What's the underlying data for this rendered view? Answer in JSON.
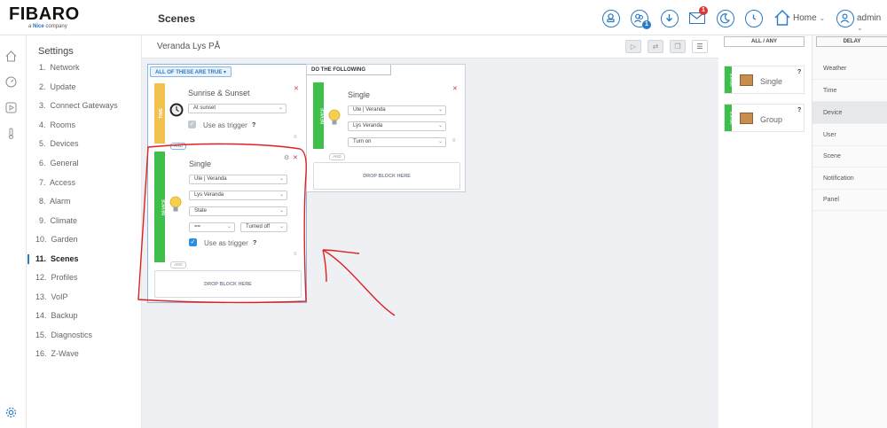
{
  "brand": {
    "name": "FIBARO",
    "tagline_prefix": "a ",
    "tagline_brand": "Nice",
    "tagline_suffix": " company"
  },
  "header": {
    "page_title": "Scenes",
    "home_label": "Home",
    "user_label": "admin",
    "users_badge": "1",
    "messages_badge": "1",
    "accent_color": "#2a7ac5",
    "badge_color": "#d9383a"
  },
  "settings": {
    "title": "Settings",
    "items": [
      {
        "num": "1.",
        "label": "Network"
      },
      {
        "num": "2.",
        "label": "Update"
      },
      {
        "num": "3.",
        "label": "Connect Gateways"
      },
      {
        "num": "4.",
        "label": "Rooms"
      },
      {
        "num": "5.",
        "label": "Devices"
      },
      {
        "num": "6.",
        "label": "General"
      },
      {
        "num": "7.",
        "label": "Access"
      },
      {
        "num": "8.",
        "label": "Alarm"
      },
      {
        "num": "9.",
        "label": "Climate"
      },
      {
        "num": "10.",
        "label": "Garden"
      },
      {
        "num": "11.",
        "label": "Scenes"
      },
      {
        "num": "12.",
        "label": "Profiles"
      },
      {
        "num": "13.",
        "label": "VoIP"
      },
      {
        "num": "14.",
        "label": "Backup"
      },
      {
        "num": "15.",
        "label": "Diagnostics"
      },
      {
        "num": "16.",
        "label": "Z-Wave"
      }
    ],
    "active_index": 10
  },
  "scene": {
    "name": "Veranda Lys PÅ"
  },
  "conditions": {
    "tab_label": "ALL OF THESE ARE TRUE",
    "and_label": "AND",
    "drop_label": "DROP BLOCK HERE",
    "time_block": {
      "strip_label": "TIME",
      "strip_color": "#f2c14e",
      "title": "Sunrise & Sunset",
      "select": "At sunset",
      "trigger_label": "Use as trigger",
      "help": "?"
    },
    "device_block": {
      "strip_label": "DEVICE",
      "strip_color": "#3dbf4a",
      "title": "Single",
      "room": "Ute | Veranda",
      "device": "Lys Veranda",
      "property": "State",
      "operator": "==",
      "value": "Turned off",
      "trigger_label": "Use as trigger",
      "help": "?"
    }
  },
  "actions": {
    "tab_label": "DO THE FOLLOWING",
    "and_label": "AND",
    "drop_label": "DROP BLOCK HERE",
    "device_block": {
      "strip_label": "DEVICE",
      "strip_color": "#3dbf4a",
      "title": "Single",
      "room": "Ute | Veranda",
      "device": "Lys Veranda",
      "action": "Turn on"
    }
  },
  "palette": {
    "headers": [
      "ALL / ANY",
      "DELAY"
    ],
    "cards": [
      {
        "strip": "DEVICE",
        "label": "Single",
        "help": "?"
      },
      {
        "strip": "DEVICE",
        "label": "Group",
        "help": "?"
      }
    ],
    "categories": [
      "Weather",
      "Time",
      "Device",
      "User",
      "Scene",
      "Notification",
      "Panel"
    ],
    "active_category": "Device"
  },
  "annotation_color": "#e02020"
}
